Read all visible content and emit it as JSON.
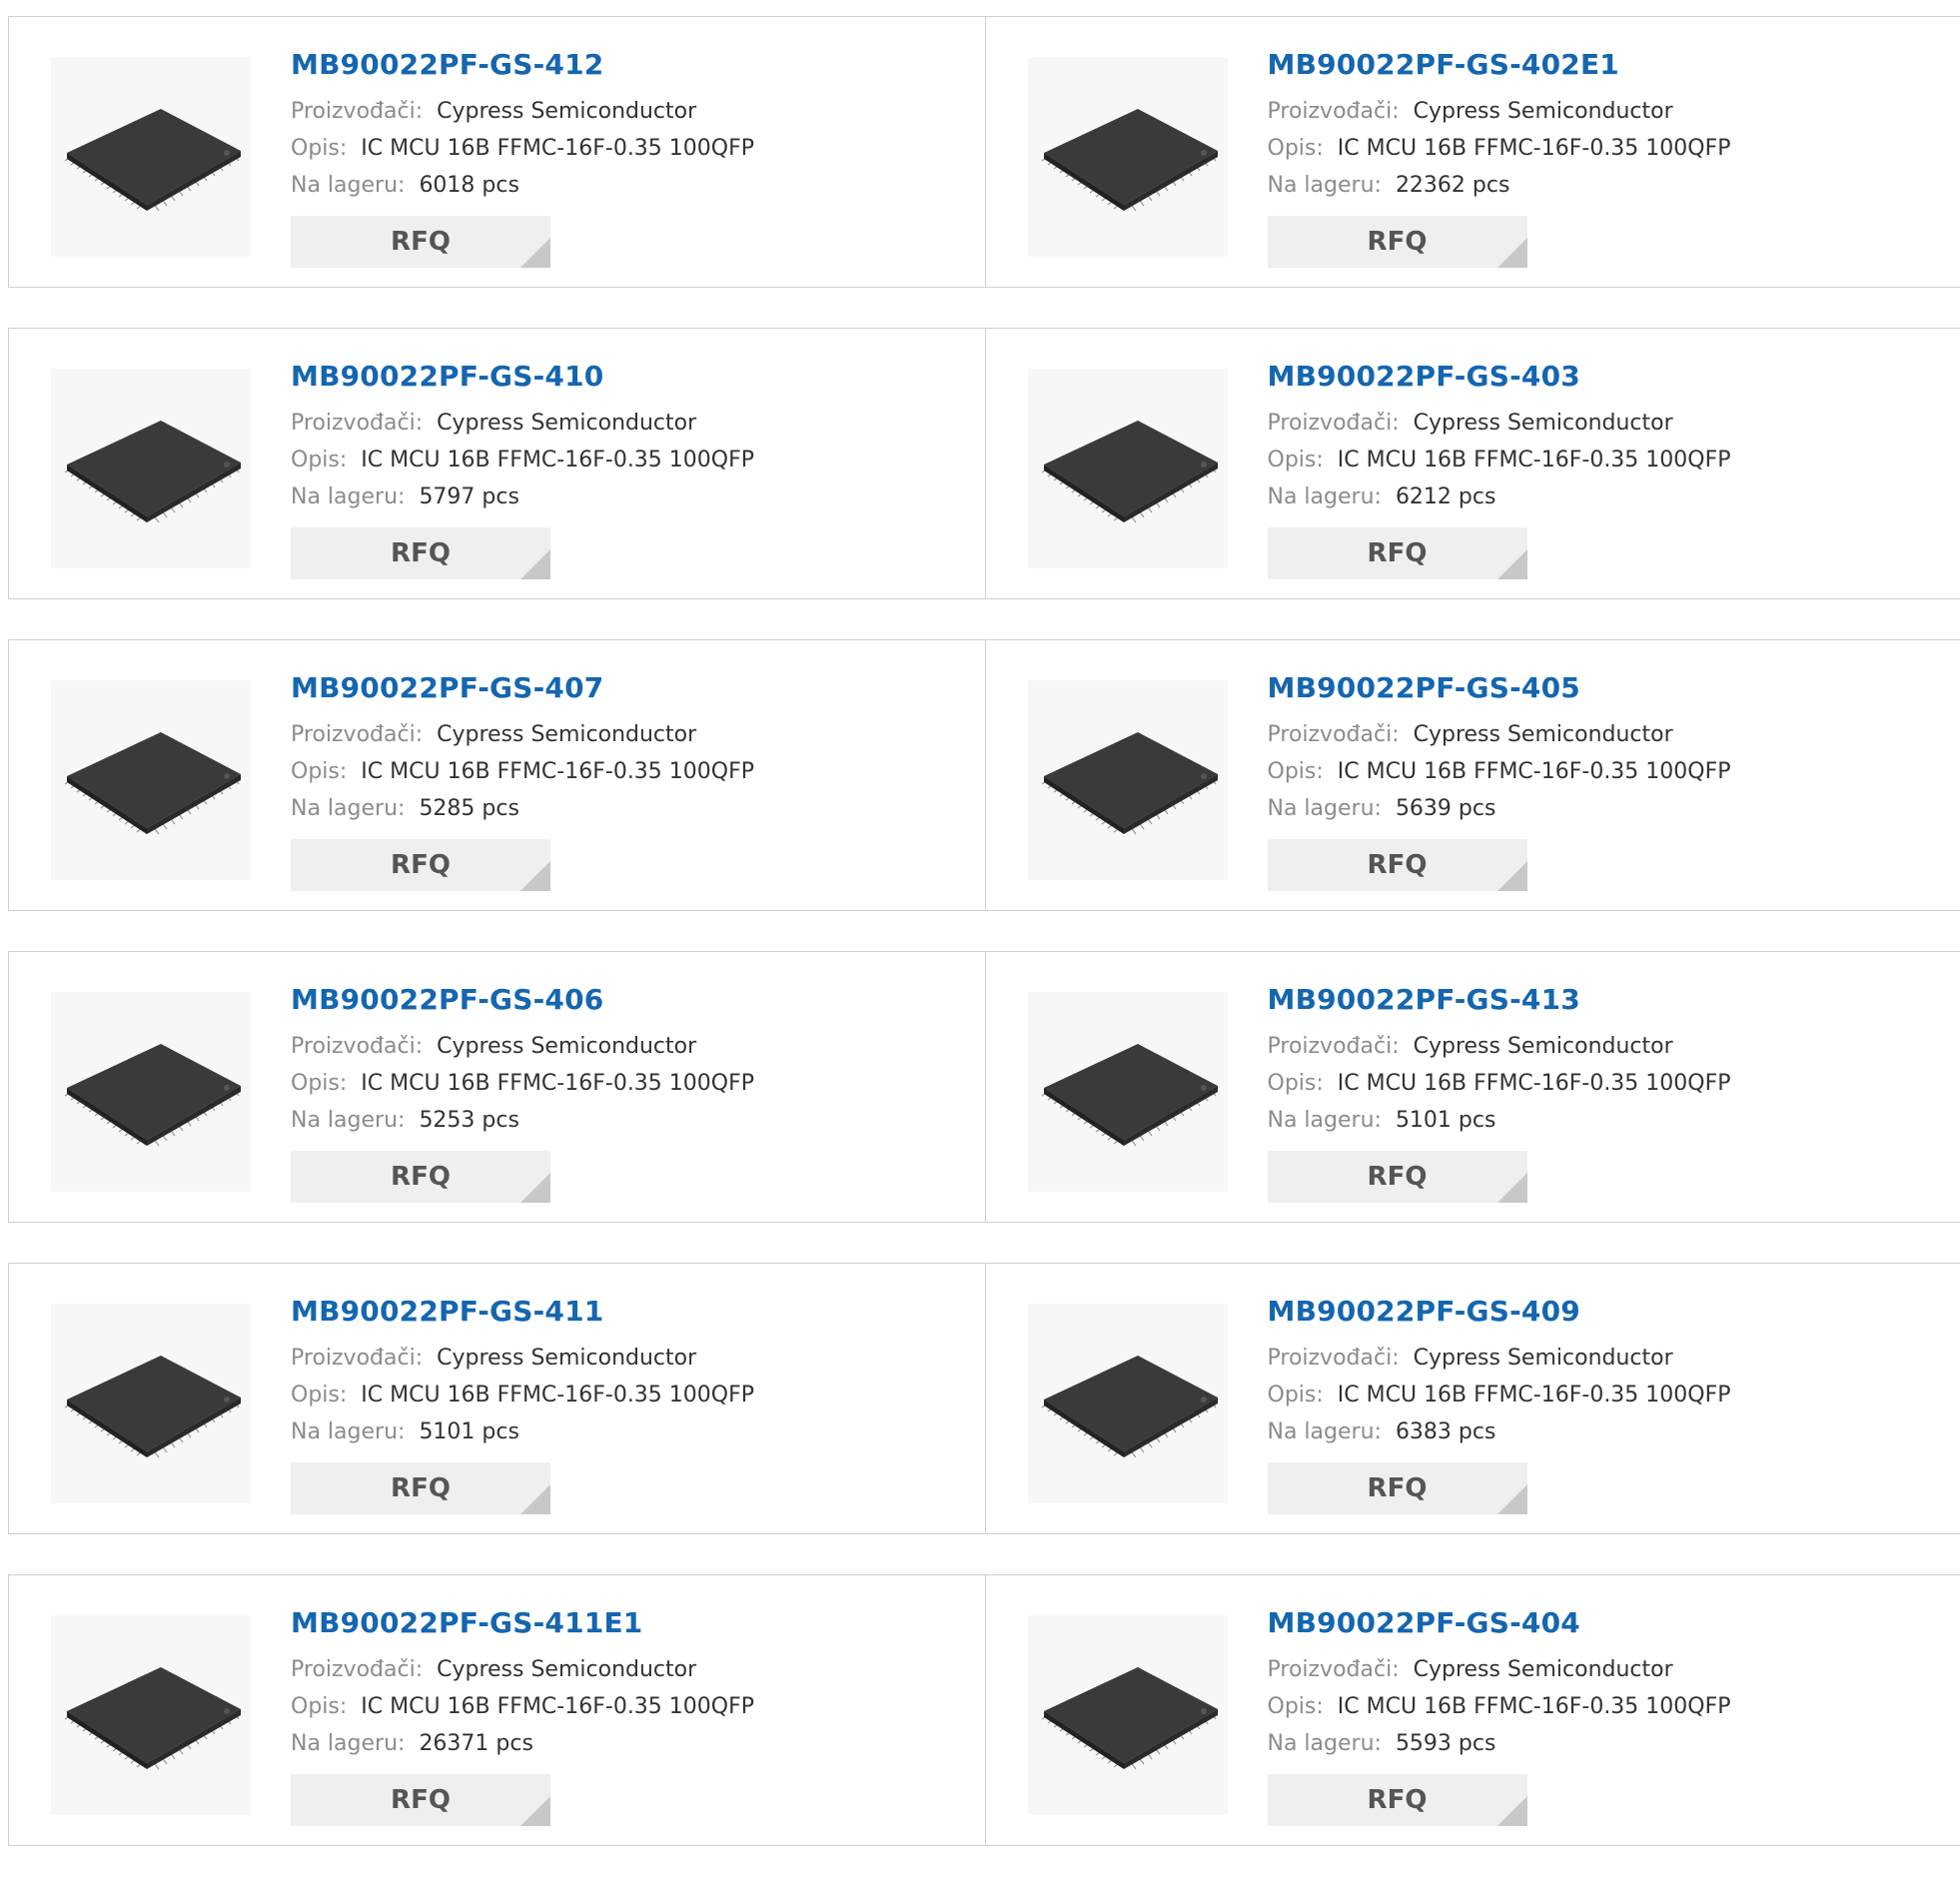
{
  "labels": {
    "manufacturer": "Proizvođači:",
    "description": "Opis:",
    "stock": "Na lageru:",
    "rfq": "RFQ"
  },
  "products": [
    {
      "name": "MB90022PF-GS-412",
      "manufacturer": "Cypress Semiconductor",
      "description": "IC MCU 16B FFMC-16F-0.35 100QFP",
      "stock": "6018 pcs"
    },
    {
      "name": "MB90022PF-GS-402E1",
      "manufacturer": "Cypress Semiconductor",
      "description": "IC MCU 16B FFMC-16F-0.35 100QFP",
      "stock": "22362 pcs"
    },
    {
      "name": "MB90022PF-GS-410",
      "manufacturer": "Cypress Semiconductor",
      "description": "IC MCU 16B FFMC-16F-0.35 100QFP",
      "stock": "5797 pcs"
    },
    {
      "name": "MB90022PF-GS-403",
      "manufacturer": "Cypress Semiconductor",
      "description": "IC MCU 16B FFMC-16F-0.35 100QFP",
      "stock": "6212 pcs"
    },
    {
      "name": "MB90022PF-GS-407",
      "manufacturer": "Cypress Semiconductor",
      "description": "IC MCU 16B FFMC-16F-0.35 100QFP",
      "stock": "5285 pcs"
    },
    {
      "name": "MB90022PF-GS-405",
      "manufacturer": "Cypress Semiconductor",
      "description": "IC MCU 16B FFMC-16F-0.35 100QFP",
      "stock": "5639 pcs"
    },
    {
      "name": "MB90022PF-GS-406",
      "manufacturer": "Cypress Semiconductor",
      "description": "IC MCU 16B FFMC-16F-0.35 100QFP",
      "stock": "5253 pcs"
    },
    {
      "name": "MB90022PF-GS-413",
      "manufacturer": "Cypress Semiconductor",
      "description": "IC MCU 16B FFMC-16F-0.35 100QFP",
      "stock": "5101 pcs"
    },
    {
      "name": "MB90022PF-GS-411",
      "manufacturer": "Cypress Semiconductor",
      "description": "IC MCU 16B FFMC-16F-0.35 100QFP",
      "stock": "5101 pcs"
    },
    {
      "name": "MB90022PF-GS-409",
      "manufacturer": "Cypress Semiconductor",
      "description": "IC MCU 16B FFMC-16F-0.35 100QFP",
      "stock": "6383 pcs"
    },
    {
      "name": "MB90022PF-GS-411E1",
      "manufacturer": "Cypress Semiconductor",
      "description": "IC MCU 16B FFMC-16F-0.35 100QFP",
      "stock": "26371 pcs"
    },
    {
      "name": "MB90022PF-GS-404",
      "manufacturer": "Cypress Semiconductor",
      "description": "IC MCU 16B FFMC-16F-0.35 100QFP",
      "stock": "5593 pcs"
    }
  ],
  "colors": {
    "title": "#1466b0",
    "label": "#8c8c8c",
    "value": "#333333",
    "button_bg": "#efefef",
    "border": "#cfcfcf"
  },
  "icons": {
    "thumbnail": "qfp-chip-icon"
  }
}
